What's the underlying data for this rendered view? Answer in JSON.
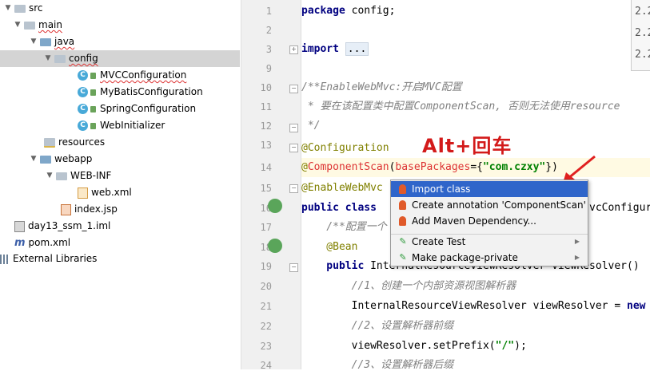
{
  "tree": [
    {
      "label": "src",
      "indent": 0,
      "arrow": "▼",
      "icon": "folder"
    },
    {
      "label": "main",
      "indent": 1,
      "arrow": "▼",
      "icon": "folder"
    },
    {
      "label": "java",
      "indent": 2,
      "arrow": "▼",
      "icon": "folder-blue"
    },
    {
      "label": "config",
      "indent": 3,
      "arrow": "▼",
      "icon": "package",
      "selected": true
    },
    {
      "label": "MVCConfiguration",
      "indent": 4,
      "icon": "class"
    },
    {
      "label": "MyBatisConfiguration",
      "indent": 4,
      "icon": "class"
    },
    {
      "label": "SpringConfiguration",
      "indent": 4,
      "icon": "class"
    },
    {
      "label": "WebInitializer",
      "indent": 4,
      "icon": "class"
    },
    {
      "label": "resources",
      "indent": 2,
      "icon": "resources"
    },
    {
      "label": "webapp",
      "indent": 1,
      "arrow": "▼",
      "icon": "folder-blue"
    },
    {
      "label": "WEB-INF",
      "indent": 2,
      "arrow": "▼",
      "icon": "folder"
    },
    {
      "label": "web.xml",
      "indent": 3,
      "icon": "xml"
    },
    {
      "label": "index.jsp",
      "indent": 2,
      "icon": "jsp"
    },
    {
      "label": "day13_ssm_1.iml",
      "indent": 0,
      "icon": "iml"
    },
    {
      "label": "pom.xml",
      "indent": 0,
      "icon": "maven"
    },
    {
      "label": "External Libraries",
      "indent": 0,
      "icon": "library"
    }
  ],
  "line_numbers": [
    "1",
    "2",
    "3",
    "9",
    "10",
    "11",
    "12",
    "13",
    "14",
    "15",
    "16",
    "17",
    "18",
    "19",
    "20",
    "21",
    "22",
    "23",
    "24"
  ],
  "code": {
    "l1_kw": "package",
    "l1_rest": " config;",
    "l3_kw": "import",
    "l3_fold": "...",
    "l10": "/**EnableWebMvc:开启MVC配置",
    "l11": " * 要在该配置类中配置ComponentScan, 否则无法使用resource",
    "l12": " */",
    "l13": "@Configuration",
    "l14_at": "@",
    "l14_ann": "ComponentScan",
    "l14_open": "(",
    "l14_attr": "basePackages",
    "l14_eq": "={",
    "l14_str": "\"com.czxy\"",
    "l14_close": "})",
    "l15": "@EnableWebMvc",
    "l16_kw": "public class",
    "l16_tail": "vcConfigure",
    "l17": "    /**配置一个",
    "l18": "    @Bean",
    "l19_kw": "    public",
    "l19_tail": " InternalResourceViewResolver viewResolver()",
    "l20": "        //1、创建一个内部资源视图解析器",
    "l21_a": "        InternalResourceViewResolver viewResolver = ",
    "l21_kw": "new",
    "l22": "        //2、设置解析器前缀",
    "l23_a": "        viewResolver.setPrefix(",
    "l23_str": "\"/\"",
    "l23_b": ");",
    "l24": "        //3、设置解析器后缀"
  },
  "popup": {
    "items": [
      {
        "label": "Import class",
        "icon": "bulb-red",
        "selected": true
      },
      {
        "label": "Create annotation 'ComponentScan'",
        "icon": "bulb-red"
      },
      {
        "label": "Add Maven Dependency...",
        "icon": "bulb-red"
      },
      {
        "label": "Create Test",
        "icon": "pencil",
        "submenu": true
      },
      {
        "label": "Make package-private",
        "icon": "pencil",
        "submenu": true
      }
    ]
  },
  "annotation_text": "Alt+回车",
  "right_panel": [
    "2.2",
    "2.2",
    "2.2"
  ]
}
